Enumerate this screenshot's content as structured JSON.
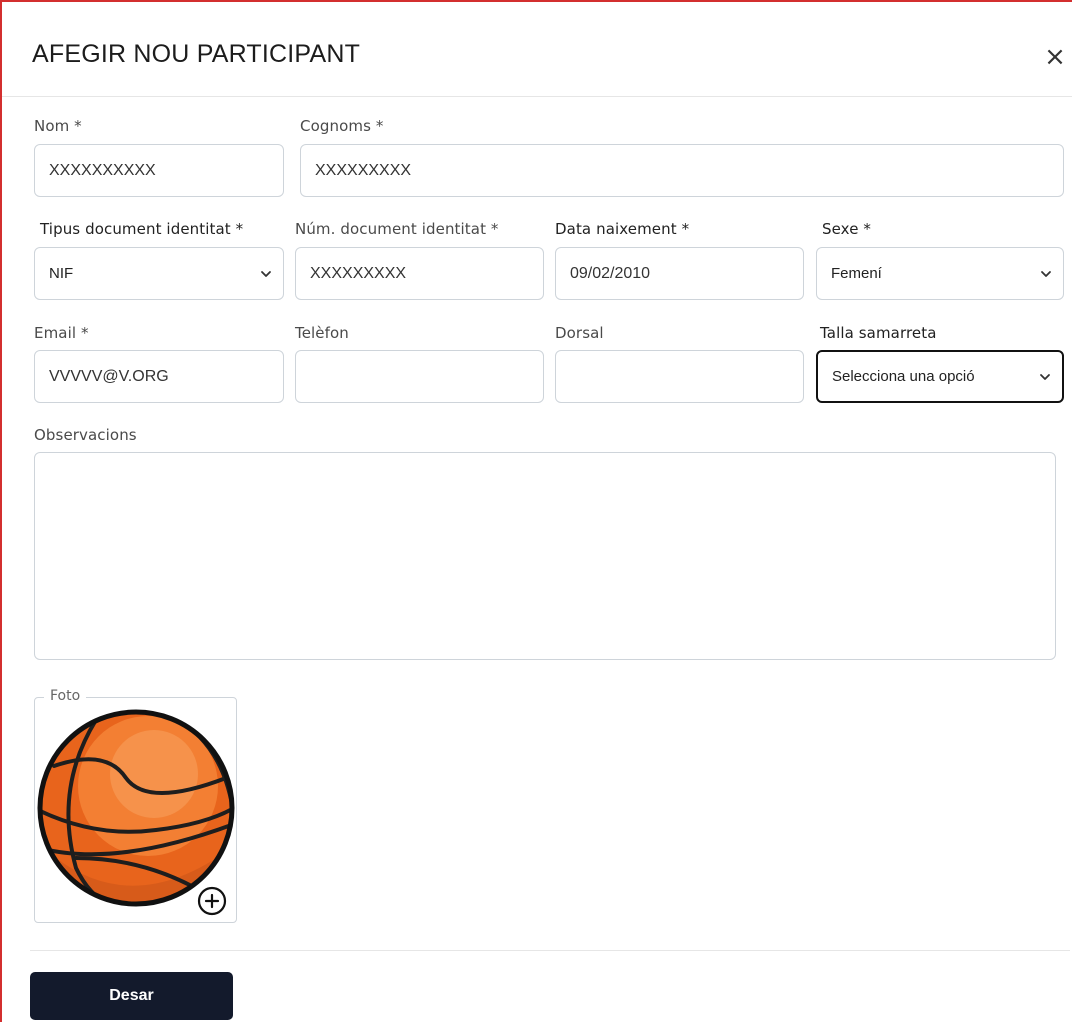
{
  "modal": {
    "title": "AFEGIR NOU PARTICIPANT",
    "close_symbol": "×"
  },
  "form": {
    "nom": {
      "label": "Nom *",
      "value": "XXXXXXXXXX"
    },
    "cognoms": {
      "label": "Cognoms *",
      "value": "XXXXXXXXX"
    },
    "tipus_document": {
      "label": "Tipus document identitat *",
      "value": "NIF"
    },
    "num_document": {
      "label": "Núm. document identitat *",
      "value": "XXXXXXXXX"
    },
    "data_naixement": {
      "label": "Data naixement *",
      "value": "09/02/2010"
    },
    "sexe": {
      "label": "Sexe *",
      "value": "Femení"
    },
    "email": {
      "label": "Email *",
      "value": "VVVVV@V.ORG"
    },
    "telefon": {
      "label": "Telèfon",
      "value": ""
    },
    "dorsal": {
      "label": "Dorsal",
      "value": ""
    },
    "talla_samarreta": {
      "label": "Talla samarreta",
      "value": "Selecciona una opció"
    },
    "observacions": {
      "label": "Observacions",
      "value": ""
    },
    "foto": {
      "label": "Foto",
      "image_icon": "basketball-icon",
      "add_icon": "plus-circle-icon"
    }
  },
  "footer": {
    "save_label": "Desar"
  },
  "colors": {
    "modal_border": "#d32f2f",
    "button_bg": "#131a2c",
    "ball_orange": "#f07b2a"
  }
}
